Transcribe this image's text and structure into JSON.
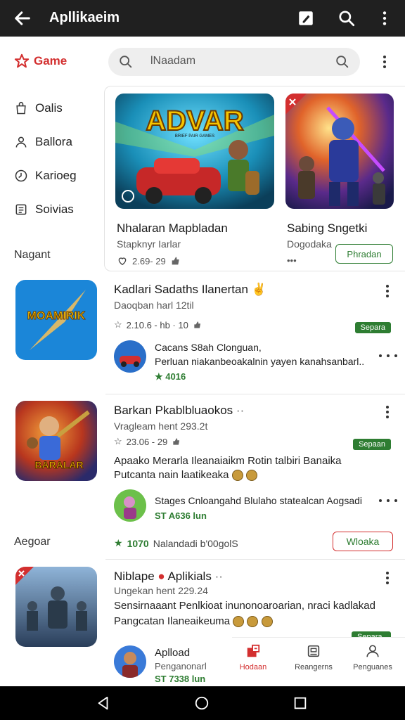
{
  "topbar": {
    "title": "Apllikaeim"
  },
  "sidebar": {
    "brand": "Game",
    "items": [
      {
        "label": "Oalis"
      },
      {
        "label": "Ballora"
      },
      {
        "label": "Karioeg"
      },
      {
        "label": "Soivias"
      }
    ],
    "section_labels": [
      "Nagant",
      "Aegoar"
    ]
  },
  "search": {
    "placeholder": "lNaadam"
  },
  "featured": [
    {
      "art_title": "ADVAR",
      "art_subtitle": "BRIEF PAIR GAMES",
      "name": "Nhalaran Mapbladan",
      "sub": "Stapknyr Iarlar",
      "meta": "2.69- 29"
    },
    {
      "name": "Sabing Sngetki",
      "sub": "Dogodaka",
      "meta": "•••",
      "button": "Phradan"
    }
  ],
  "list": [
    {
      "title": "Kadlari Sadaths Ilanertan",
      "sub": "Daoqban harl 12til",
      "meta": "2.10.6 - hb · 10",
      "badge": "Separa",
      "thumb_text": "MOAMIRIK",
      "subitem": {
        "line1": "Cacans S8ah Clonguan,",
        "line2": "Perluan niakanbeoakalnin yayen kanahsanbarl..",
        "price": "4016"
      }
    },
    {
      "title": "Barkan Pkablbluaokos",
      "sub": "Vragleam hent 293.2t",
      "meta": "23.06 - 29",
      "badge": "Sepaan",
      "thumb_text": "BARALAR",
      "desc1": "Apaako Merarla Ileanaiaikm Rotin talbiri Banaika",
      "desc2": "Putcanta nain laatikeaka",
      "subitem": {
        "line1": "Stages Cnloangahd Blulaho statealcan Aogsadi",
        "price": "ST A636 lun"
      },
      "footer_price": "1070",
      "footer_text": "Nalandadi b'00golS",
      "footer_button": "Wloaka"
    },
    {
      "title": "Niblape",
      "title2": "Aplikials",
      "sub": "Ungekan hent 229.24",
      "desc1": "Sensirnaaant Penlkioat inunonoaroarian, nraci kadlakad",
      "desc2": "Pangcatan Ilaneaikeuma",
      "badge": "Separa",
      "subitem": {
        "line1": "Aplload",
        "line2": "Penganonarl",
        "price": "ST 7338 lun"
      }
    }
  ],
  "bottom_tabs": [
    {
      "label": "Hodaan"
    },
    {
      "label": "Reangerns"
    },
    {
      "label": "Penguanes"
    }
  ],
  "colors": {
    "accent": "#d32f2f",
    "green": "#2e7d32",
    "topbar": "#202020"
  }
}
